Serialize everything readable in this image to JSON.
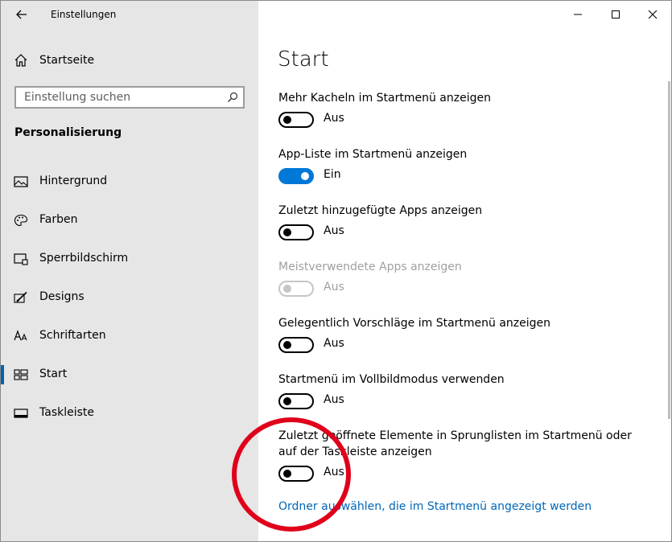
{
  "window": {
    "title": "Einstellungen"
  },
  "sidebar": {
    "home_label": "Startseite",
    "search_placeholder": "Einstellung suchen",
    "section_title": "Personalisierung",
    "items": [
      {
        "label": "Hintergrund",
        "icon": "picture-icon",
        "selected": false
      },
      {
        "label": "Farben",
        "icon": "palette-icon",
        "selected": false
      },
      {
        "label": "Sperrbildschirm",
        "icon": "lock-screen-icon",
        "selected": false
      },
      {
        "label": "Designs",
        "icon": "paintbrush-icon",
        "selected": false
      },
      {
        "label": "Schriftarten",
        "icon": "fonts-icon",
        "selected": false
      },
      {
        "label": "Start",
        "icon": "start-tiles-icon",
        "selected": true
      },
      {
        "label": "Taskleiste",
        "icon": "taskbar-icon",
        "selected": false
      }
    ]
  },
  "main": {
    "title": "Start",
    "settings": [
      {
        "label": "Mehr Kacheln im Startmenü anzeigen",
        "state": "Aus",
        "on": false,
        "disabled": false
      },
      {
        "label": "App-Liste im Startmenü anzeigen",
        "state": "Ein",
        "on": true,
        "disabled": false
      },
      {
        "label": "Zuletzt hinzugefügte Apps anzeigen",
        "state": "Aus",
        "on": false,
        "disabled": false
      },
      {
        "label": "Meistverwendete Apps anzeigen",
        "state": "Aus",
        "on": false,
        "disabled": true
      },
      {
        "label": "Gelegentlich Vorschläge im Startmenü anzeigen",
        "state": "Aus",
        "on": false,
        "disabled": false
      },
      {
        "label": "Startmenü im Vollbildmodus verwenden",
        "state": "Aus",
        "on": false,
        "disabled": false
      },
      {
        "label": "Zuletzt geöffnete Elemente in Sprunglisten im Startmenü oder auf der Taskleiste anzeigen",
        "state": "Aus",
        "on": false,
        "disabled": false
      }
    ],
    "link": "Ordner auswählen, die im Startmenü angezeigt werden"
  },
  "colors": {
    "accent": "#0078d7",
    "link": "#0067b8",
    "annotation": "#e0001b",
    "sidebar_bg": "#e6e6e6"
  }
}
